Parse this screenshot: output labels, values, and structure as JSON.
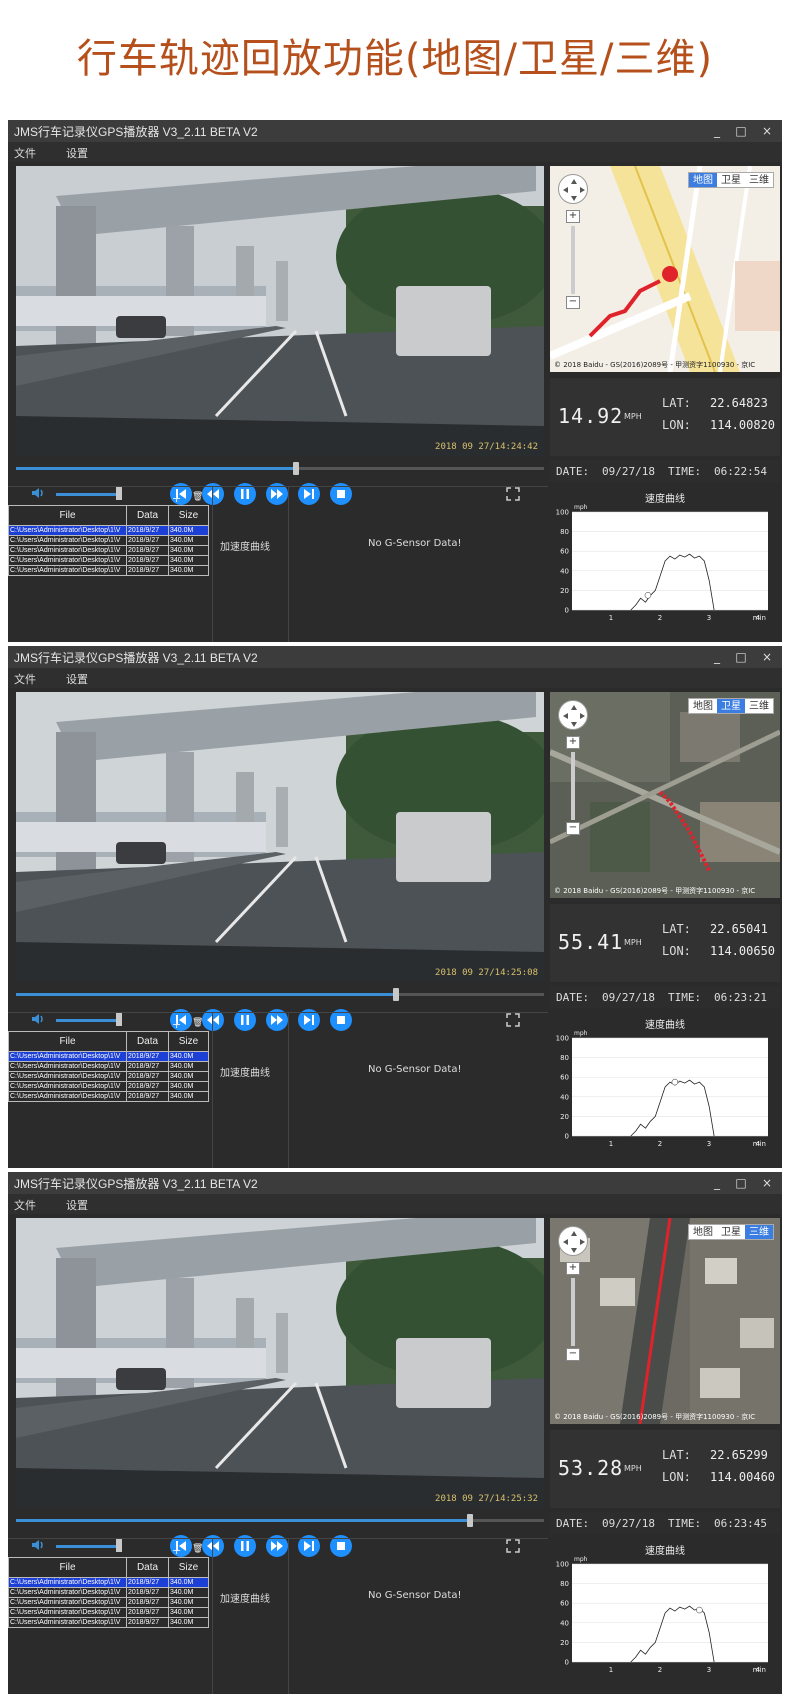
{
  "banner": {
    "title": "行车轨迹回放功能(地图/卫星/三维)"
  },
  "colors": {
    "accent": "#1e90ff",
    "banner": "#b5501c",
    "selected_row": "#1c3fd6"
  },
  "window_controls": [
    "_",
    "□",
    "×"
  ],
  "panels": [
    {
      "window_title": "JMS行车记录仪GPS播放器  V3_2.11 BETA V2",
      "menu": [
        "文件",
        "设置"
      ],
      "timestamp": "2018 09 27/14:24:42",
      "seek_progress": 0.53,
      "map_tabs": [
        "地图",
        "卫星",
        "三维"
      ],
      "map_active_tab": 0,
      "map_copyright": "© 2018 Baidu - GS(2016)2089号 - 甲测资字1100930 - 京IC",
      "speed": "14.92",
      "speed_unit": "MPH",
      "lat_label": "LAT:",
      "lat": "22.64823",
      "lon_label": "LON:",
      "lon": "114.00820",
      "date_label": "DATE:",
      "date": "09/27/18",
      "time_label": "TIME:",
      "time": "06:22:54",
      "table_headers": [
        "File",
        "Data",
        "Size"
      ],
      "files": [
        [
          "C:\\Users\\Administrator\\Desktop\\1\\V",
          "2018/9/27",
          "340.0M"
        ],
        [
          "C:\\Users\\Administrator\\Desktop\\1\\V",
          "2018/9/27",
          "340.0M"
        ],
        [
          "C:\\Users\\Administrator\\Desktop\\1\\V",
          "2018/9/27",
          "340.0M"
        ],
        [
          "C:\\Users\\Administrator\\Desktop\\1\\V",
          "2018/9/27",
          "340.0M"
        ],
        [
          "C:\\Users\\Administrator\\Desktop\\1\\V",
          "2018/9/27",
          "340.0M"
        ]
      ],
      "add_label": "+",
      "delete_label": "🗑",
      "accel_label": "加速度曲线",
      "gsensor_label": "No G-Sensor Data!",
      "chart_data": {
        "type": "line",
        "title": "速度曲线",
        "ylabel": "mph",
        "xlabel": "min",
        "ylim": [
          0,
          100
        ],
        "xlim": [
          0,
          4
        ],
        "yticks": [
          "0",
          "20",
          "40",
          "60",
          "80",
          "100"
        ],
        "xticks": [
          "1",
          "2",
          "3",
          "4"
        ],
        "x": [
          1.2,
          1.3,
          1.4,
          1.5,
          1.6,
          1.7,
          1.8,
          1.9,
          2.0,
          2.1,
          2.2,
          2.3,
          2.4,
          2.5,
          2.6,
          2.7,
          2.8,
          2.9
        ],
        "y": [
          0,
          5,
          12,
          8,
          15,
          20,
          35,
          50,
          55,
          52,
          56,
          54,
          57,
          53,
          55,
          50,
          30,
          0
        ],
        "marker": {
          "x": 1.55,
          "y": 15
        }
      }
    },
    {
      "window_title": "JMS行车记录仪GPS播放器  V3_2.11 BETA V2",
      "menu": [
        "文件",
        "设置"
      ],
      "timestamp": "2018 09 27/14:25:08",
      "seek_progress": 0.72,
      "map_tabs": [
        "地图",
        "卫星",
        "三维"
      ],
      "map_active_tab": 1,
      "map_copyright": "© 2018 Baidu - GS(2016)2089号 - 甲测资字1100930 - 京IC",
      "speed": "55.41",
      "speed_unit": "MPH",
      "lat_label": "LAT:",
      "lat": "22.65041",
      "lon_label": "LON:",
      "lon": "114.00650",
      "date_label": "DATE:",
      "date": "09/27/18",
      "time_label": "TIME:",
      "time": "06:23:21",
      "table_headers": [
        "File",
        "Data",
        "Size"
      ],
      "files": [
        [
          "C:\\Users\\Administrator\\Desktop\\1\\V",
          "2018/9/27",
          "340.0M"
        ],
        [
          "C:\\Users\\Administrator\\Desktop\\1\\V",
          "2018/9/27",
          "340.0M"
        ],
        [
          "C:\\Users\\Administrator\\Desktop\\1\\V",
          "2018/9/27",
          "340.0M"
        ],
        [
          "C:\\Users\\Administrator\\Desktop\\1\\V",
          "2018/9/27",
          "340.0M"
        ],
        [
          "C:\\Users\\Administrator\\Desktop\\1\\V",
          "2018/9/27",
          "340.0M"
        ]
      ],
      "add_label": "+",
      "delete_label": "🗑",
      "accel_label": "加速度曲线",
      "gsensor_label": "No G-Sensor Data!",
      "chart_data": {
        "type": "line",
        "title": "速度曲线",
        "ylabel": "mph",
        "xlabel": "min",
        "ylim": [
          0,
          100
        ],
        "xlim": [
          0,
          4
        ],
        "yticks": [
          "0",
          "20",
          "40",
          "60",
          "80",
          "100"
        ],
        "xticks": [
          "1",
          "2",
          "3",
          "4"
        ],
        "x": [
          1.2,
          1.3,
          1.4,
          1.5,
          1.6,
          1.7,
          1.8,
          1.9,
          2.0,
          2.1,
          2.2,
          2.3,
          2.4,
          2.5,
          2.6,
          2.7,
          2.8,
          2.9
        ],
        "y": [
          0,
          5,
          12,
          8,
          15,
          20,
          35,
          50,
          55,
          52,
          56,
          54,
          57,
          53,
          55,
          50,
          30,
          0
        ],
        "marker": {
          "x": 2.1,
          "y": 55
        }
      }
    },
    {
      "window_title": "JMS行车记录仪GPS播放器  V3_2.11 BETA V2",
      "menu": [
        "文件",
        "设置"
      ],
      "timestamp": "2018 09 27/14:25:32",
      "seek_progress": 0.86,
      "map_tabs": [
        "地图",
        "卫星",
        "三维"
      ],
      "map_active_tab": 2,
      "map_copyright": "© 2018 Baidu - GS(2016)2089号 - 甲测资字1100930 - 京IC",
      "speed": "53.28",
      "speed_unit": "MPH",
      "lat_label": "LAT:",
      "lat": "22.65299",
      "lon_label": "LON:",
      "lon": "114.00460",
      "date_label": "DATE:",
      "date": "09/27/18",
      "time_label": "TIME:",
      "time": "06:23:45",
      "table_headers": [
        "File",
        "Data",
        "Size"
      ],
      "files": [
        [
          "C:\\Users\\Administrator\\Desktop\\1\\V",
          "2018/9/27",
          "340.0M"
        ],
        [
          "C:\\Users\\Administrator\\Desktop\\1\\V",
          "2018/9/27",
          "340.0M"
        ],
        [
          "C:\\Users\\Administrator\\Desktop\\1\\V",
          "2018/9/27",
          "340.0M"
        ],
        [
          "C:\\Users\\Administrator\\Desktop\\1\\V",
          "2018/9/27",
          "340.0M"
        ],
        [
          "C:\\Users\\Administrator\\Desktop\\1\\V",
          "2018/9/27",
          "340.0M"
        ]
      ],
      "add_label": "+",
      "delete_label": "🗑",
      "accel_label": "加速度曲线",
      "gsensor_label": "No G-Sensor Data!",
      "chart_data": {
        "type": "line",
        "title": "速度曲线",
        "ylabel": "mph",
        "xlabel": "min",
        "ylim": [
          0,
          100
        ],
        "xlim": [
          0,
          4
        ],
        "yticks": [
          "0",
          "20",
          "40",
          "60",
          "80",
          "100"
        ],
        "xticks": [
          "1",
          "2",
          "3",
          "4"
        ],
        "x": [
          1.2,
          1.3,
          1.4,
          1.5,
          1.6,
          1.7,
          1.8,
          1.9,
          2.0,
          2.1,
          2.2,
          2.3,
          2.4,
          2.5,
          2.6,
          2.7,
          2.8,
          2.9
        ],
        "y": [
          0,
          5,
          12,
          8,
          15,
          20,
          35,
          50,
          55,
          52,
          56,
          54,
          57,
          53,
          55,
          50,
          30,
          0
        ],
        "marker": {
          "x": 2.6,
          "y": 53
        }
      }
    }
  ]
}
